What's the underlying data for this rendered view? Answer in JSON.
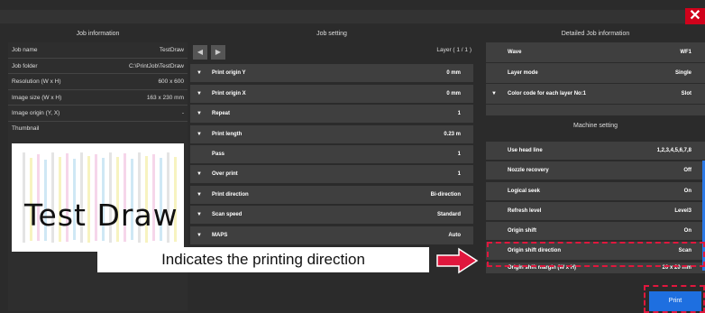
{
  "window": {
    "close_label": "✕"
  },
  "headers": {
    "job_info": "Job information",
    "job_setting": "Job setting",
    "detailed_info": "Detailed Job information",
    "machine_setting": "Machine setting"
  },
  "job_info": {
    "rows": [
      {
        "label": "Job name",
        "value": "TestDraw"
      },
      {
        "label": "Job folder",
        "value": "C:\\PrintJob\\TestDraw"
      },
      {
        "label": "Resolution (W x H)",
        "value": "600 x 600"
      },
      {
        "label": "Image size (W x H)",
        "value": "163 x 230 mm"
      },
      {
        "label": "Image origin (Y, X)",
        "value": "-"
      }
    ],
    "thumbnail_label": "Thumbnail",
    "thumbnail_text": "Test Draw"
  },
  "job_setting": {
    "layer_label": "Layer ( 1 / 1 )",
    "prev_icon": "◀",
    "next_icon": "▶",
    "rows": [
      {
        "arrow": "▼",
        "label": "Print origin Y",
        "value": "0 mm"
      },
      {
        "arrow": "▼",
        "label": "Print origin X",
        "value": "0 mm"
      },
      {
        "arrow": "▼",
        "label": "Repeat",
        "value": "1"
      },
      {
        "arrow": "▼",
        "label": "Print length",
        "value": "0.23 m"
      },
      {
        "arrow": "",
        "label": "Pass",
        "value": "1"
      },
      {
        "arrow": "▼",
        "label": "Over print",
        "value": "1"
      },
      {
        "arrow": "▼",
        "label": "Print direction",
        "value": "Bi-direction"
      },
      {
        "arrow": "▼",
        "label": "Scan speed",
        "value": "Standard"
      },
      {
        "arrow": "▼",
        "label": "MAPS",
        "value": "Auto"
      }
    ]
  },
  "detailed": {
    "rows": [
      {
        "arrow": "",
        "label": "Wave",
        "value": "WF1"
      },
      {
        "arrow": "",
        "label": "Layer mode",
        "value": "Single"
      },
      {
        "arrow": "▼",
        "label": "Color code for each layer No:1",
        "value": "Slot"
      }
    ]
  },
  "machine": {
    "rows": [
      {
        "label": "Use head line",
        "value": "1,2,3,4,5,6,7,8"
      },
      {
        "label": "Nozzle recovery",
        "value": "Off"
      },
      {
        "label": "Logical seek",
        "value": "On"
      },
      {
        "label": "Refresh level",
        "value": "Level3"
      },
      {
        "label": "Origin shift",
        "value": "On"
      },
      {
        "label": "Origin shift direction",
        "value": "Scan"
      },
      {
        "label": "Origin shift margin (W x H)",
        "value": "20 x 20 mm"
      }
    ]
  },
  "callout": {
    "text": "Indicates the printing direction"
  },
  "print_button": {
    "label": "Print"
  },
  "colors": {
    "accent": "#1e6fe0",
    "highlight": "#e0173d",
    "close": "#d0021b"
  }
}
